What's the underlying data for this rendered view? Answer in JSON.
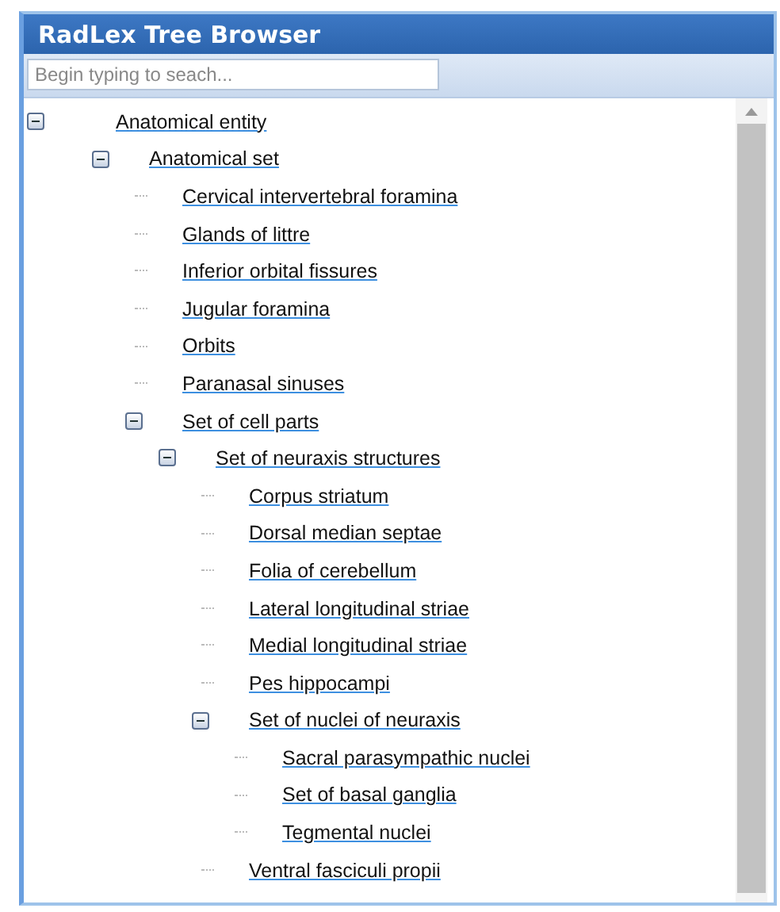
{
  "panel": {
    "title": "RadLex Tree Browser"
  },
  "search": {
    "placeholder": "Begin typing to seach..."
  },
  "tree": [
    {
      "label": "Anatomical entity",
      "expanded": true,
      "children": [
        {
          "label": "Anatomical set",
          "expanded": true,
          "children": [
            {
              "label": "Cervical intervertebral foramina"
            },
            {
              "label": "Glands of littre"
            },
            {
              "label": "Inferior orbital fissures"
            },
            {
              "label": "Jugular foramina"
            },
            {
              "label": "Orbits"
            },
            {
              "label": "Paranasal sinuses"
            },
            {
              "label": "Set of cell parts",
              "expanded": true,
              "children": [
                {
                  "label": "Set of neuraxis structures",
                  "expanded": true,
                  "children": [
                    {
                      "label": "Corpus striatum"
                    },
                    {
                      "label": "Dorsal median septae"
                    },
                    {
                      "label": "Folia of cerebellum"
                    },
                    {
                      "label": "Lateral longitudinal striae"
                    },
                    {
                      "label": "Medial longitudinal striae"
                    },
                    {
                      "label": "Pes hippocampi"
                    },
                    {
                      "label": "Set of nuclei of neuraxis",
                      "expanded": true,
                      "children": [
                        {
                          "label": "Sacral parasympathic nuclei"
                        },
                        {
                          "label": "Set of basal ganglia"
                        },
                        {
                          "label": "Tegmental nuclei"
                        }
                      ]
                    },
                    {
                      "label": "Ventral fasciculi propii"
                    }
                  ]
                }
              ]
            }
          ]
        }
      ]
    }
  ]
}
